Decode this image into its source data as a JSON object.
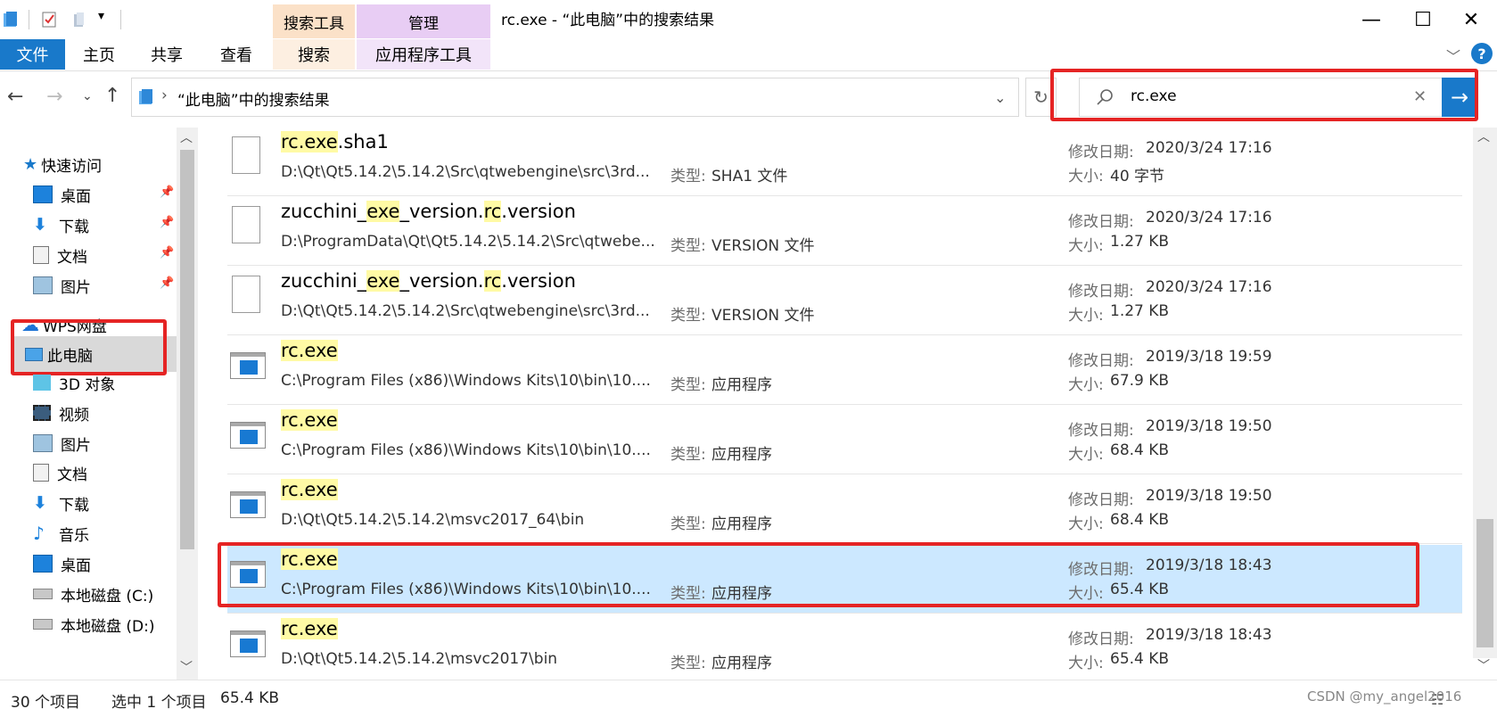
{
  "window": {
    "title": "rc.exe - “此电脑”中的搜索结果",
    "context_tab_search": "搜索工具",
    "context_tab_manage": "管理",
    "minimize": "—",
    "maximize": "☐",
    "close": "✕"
  },
  "ribbon": {
    "tabs": [
      "文件",
      "主页",
      "共享",
      "查看",
      "搜索",
      "应用程序工具"
    ],
    "help": "?"
  },
  "address": {
    "path": "“此电脑”中的搜索结果",
    "breadcrumb_sep": "›"
  },
  "search": {
    "value": "rc.exe",
    "clear": "✕",
    "go": "→"
  },
  "nav": {
    "quick_access": "快速访问",
    "quick_items": [
      "桌面",
      "下载",
      "文档",
      "图片"
    ],
    "wps": "WPS网盘",
    "this_pc": "此电脑",
    "pc_items": [
      "3D 对象",
      "视频",
      "图片",
      "文档",
      "下载",
      "音乐",
      "桌面",
      "本地磁盘 (C:)",
      "本地磁盘 (D:)"
    ]
  },
  "labels": {
    "type": "类型:",
    "modified": "修改日期:",
    "size": "大小:"
  },
  "files": [
    {
      "name_parts": [
        [
          "rc.exe",
          true
        ],
        [
          ".sha1",
          false
        ]
      ],
      "path": "D:\\Qt\\Qt5.14.2\\5.14.2\\Src\\qtwebengine\\src\\3rd...",
      "type": "SHA1 文件",
      "date": "2020/3/24 17:16",
      "size": "40 字节",
      "icon": "doc"
    },
    {
      "name_parts": [
        [
          "zucchini_",
          false
        ],
        [
          "exe",
          true
        ],
        [
          "_version.",
          false
        ],
        [
          "rc",
          true
        ],
        [
          ".version",
          false
        ]
      ],
      "path": "D:\\ProgramData\\Qt\\Qt5.14.2\\5.14.2\\Src\\qtwebe...",
      "type": "VERSION 文件",
      "date": "2020/3/24 17:16",
      "size": "1.27 KB",
      "icon": "doc"
    },
    {
      "name_parts": [
        [
          "zucchini_",
          false
        ],
        [
          "exe",
          true
        ],
        [
          "_version.",
          false
        ],
        [
          "rc",
          true
        ],
        [
          ".version",
          false
        ]
      ],
      "path": "D:\\Qt\\Qt5.14.2\\5.14.2\\Src\\qtwebengine\\src\\3rd...",
      "type": "VERSION 文件",
      "date": "2020/3/24 17:16",
      "size": "1.27 KB",
      "icon": "doc"
    },
    {
      "name_parts": [
        [
          "rc.exe",
          true
        ]
      ],
      "path": "C:\\Program Files (x86)\\Windows Kits\\10\\bin\\10....",
      "type": "应用程序",
      "date": "2019/3/18 19:59",
      "size": "67.9 KB",
      "icon": "app"
    },
    {
      "name_parts": [
        [
          "rc.exe",
          true
        ]
      ],
      "path": "C:\\Program Files (x86)\\Windows Kits\\10\\bin\\10....",
      "type": "应用程序",
      "date": "2019/3/18 19:50",
      "size": "68.4 KB",
      "icon": "app"
    },
    {
      "name_parts": [
        [
          "rc.exe",
          true
        ]
      ],
      "path": "D:\\Qt\\Qt5.14.2\\5.14.2\\msvc2017_64\\bin",
      "type": "应用程序",
      "date": "2019/3/18 19:50",
      "size": "68.4 KB",
      "icon": "app"
    },
    {
      "name_parts": [
        [
          "rc.exe",
          true
        ]
      ],
      "path": "C:\\Program Files (x86)\\Windows Kits\\10\\bin\\10....",
      "type": "应用程序",
      "date": "2019/3/18 18:43",
      "size": "65.4 KB",
      "icon": "app",
      "selected": true
    },
    {
      "name_parts": [
        [
          "rc.exe",
          true
        ]
      ],
      "path": "D:\\Qt\\Qt5.14.2\\5.14.2\\msvc2017\\bin",
      "type": "应用程序",
      "date": "2019/3/18 18:43",
      "size": "65.4 KB",
      "icon": "app"
    }
  ],
  "status": {
    "count": "30 个项目",
    "selected": "选中 1 个项目",
    "selected_size": "65.4 KB"
  },
  "watermark": "CSDN @my_angel2016",
  "colors": {
    "accent": "#1979ca",
    "selection": "#cce8ff",
    "highlight": "#fffaa5",
    "annotation_red": "#e52424"
  }
}
